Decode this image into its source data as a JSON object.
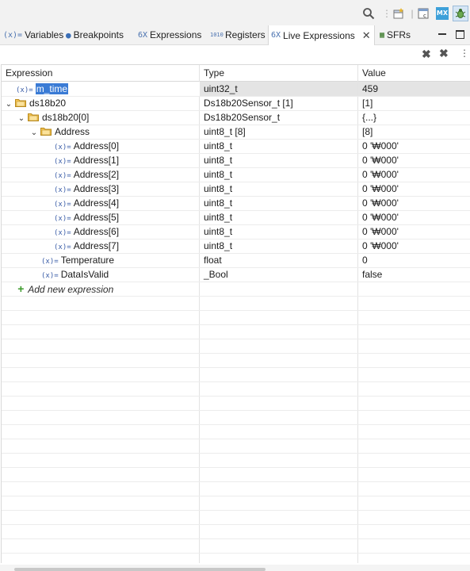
{
  "tabs": [
    {
      "label": "Variables",
      "icon": "variables-icon",
      "glyph": "(x)="
    },
    {
      "label": "Breakpoints",
      "icon": "breakpoints-icon",
      "glyph": "●"
    },
    {
      "label": "Expressions",
      "icon": "expressions-icon",
      "glyph": "6X"
    },
    {
      "label": "Registers",
      "icon": "registers-icon",
      "glyph": "1010"
    },
    {
      "label": "Live Expressions",
      "icon": "live-expressions-icon",
      "glyph": "6X"
    },
    {
      "label": "SFRs",
      "icon": "sfrs-icon",
      "glyph": "▦"
    }
  ],
  "top_icons": {
    "mx_label": "MX"
  },
  "columns": {
    "expression": "Expression",
    "type": "Type",
    "value": "Value"
  },
  "rows": [
    {
      "expr": "m_time",
      "type": "uint32_t",
      "value": "459",
      "depth": 0,
      "kind": "var",
      "selected": true
    },
    {
      "expr": "ds18b20",
      "type": "Ds18b20Sensor_t [1]",
      "value": "[1]",
      "depth": 0,
      "kind": "folder"
    },
    {
      "expr": "ds18b20[0]",
      "type": "Ds18b20Sensor_t",
      "value": "{...}",
      "depth": 1,
      "kind": "folder"
    },
    {
      "expr": "Address",
      "type": "uint8_t [8]",
      "value": "[8]",
      "depth": 2,
      "kind": "folder"
    },
    {
      "expr": "Address[0]",
      "type": "uint8_t",
      "value": "0 '₩000'",
      "depth": 3,
      "kind": "var"
    },
    {
      "expr": "Address[1]",
      "type": "uint8_t",
      "value": "0 '₩000'",
      "depth": 3,
      "kind": "var"
    },
    {
      "expr": "Address[2]",
      "type": "uint8_t",
      "value": "0 '₩000'",
      "depth": 3,
      "kind": "var"
    },
    {
      "expr": "Address[3]",
      "type": "uint8_t",
      "value": "0 '₩000'",
      "depth": 3,
      "kind": "var"
    },
    {
      "expr": "Address[4]",
      "type": "uint8_t",
      "value": "0 '₩000'",
      "depth": 3,
      "kind": "var"
    },
    {
      "expr": "Address[5]",
      "type": "uint8_t",
      "value": "0 '₩000'",
      "depth": 3,
      "kind": "var"
    },
    {
      "expr": "Address[6]",
      "type": "uint8_t",
      "value": "0 '₩000'",
      "depth": 3,
      "kind": "var"
    },
    {
      "expr": "Address[7]",
      "type": "uint8_t",
      "value": "0 '₩000'",
      "depth": 3,
      "kind": "var"
    },
    {
      "expr": "Temperature",
      "type": "float",
      "value": "0",
      "depth": 2,
      "kind": "var"
    },
    {
      "expr": "DataIsValid",
      "type": "_Bool",
      "value": "false",
      "depth": 2,
      "kind": "var"
    }
  ],
  "add_expression_label": "Add new expression",
  "var_glyph": "(x)="
}
